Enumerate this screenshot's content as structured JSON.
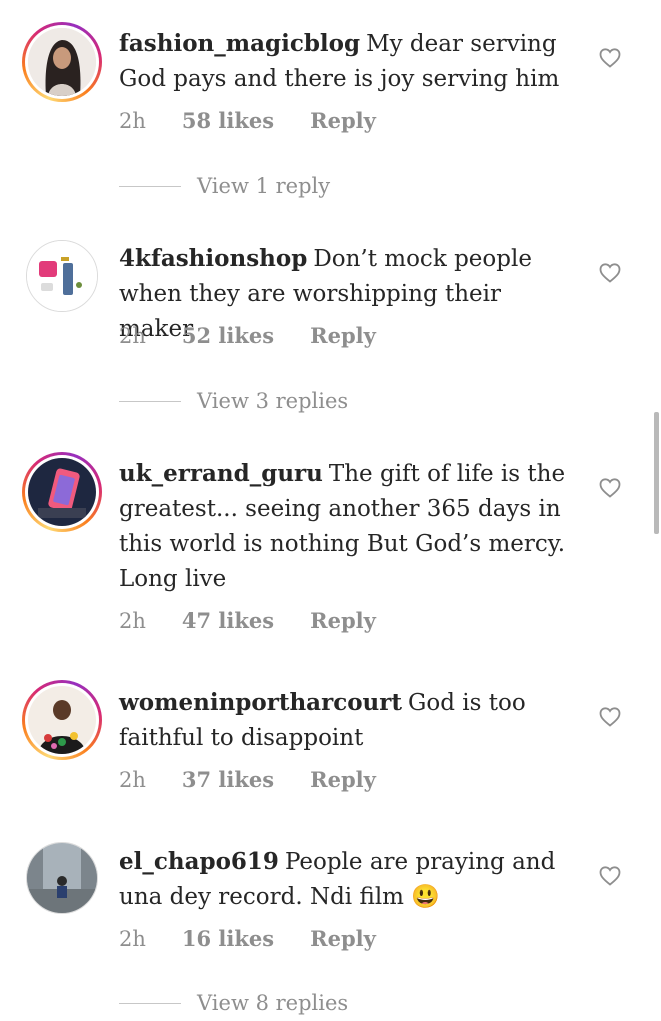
{
  "comments": [
    {
      "username": "fashion_magicblog",
      "text": "My dear serving God pays and there is joy serving him",
      "time": "2h",
      "likes": "58 likes",
      "reply": "Reply",
      "view_replies": "View 1 reply"
    },
    {
      "username": "4kfashionshop",
      "text": "Don’t mock people when they are worshipping their maker",
      "time": "2h",
      "likes": "52 likes",
      "reply": "Reply",
      "view_replies": "View 3 replies"
    },
    {
      "username": "uk_errand_guru",
      "text": "The gift of life is the greatest... seeing another 365 days in this world is nothing But God’s mercy. Long live",
      "time": "2h",
      "likes": "47 likes",
      "reply": "Reply"
    },
    {
      "username": "womeninportharcourt",
      "text": "God is too faithful to disappoint",
      "time": "2h",
      "likes": "37 likes",
      "reply": "Reply"
    },
    {
      "username": "el_chapo619",
      "text": "People are praying and una dey record. Ndi film 😃",
      "time": "2h",
      "likes": "16 likes",
      "reply": "Reply",
      "view_replies": "View 8 replies"
    }
  ]
}
